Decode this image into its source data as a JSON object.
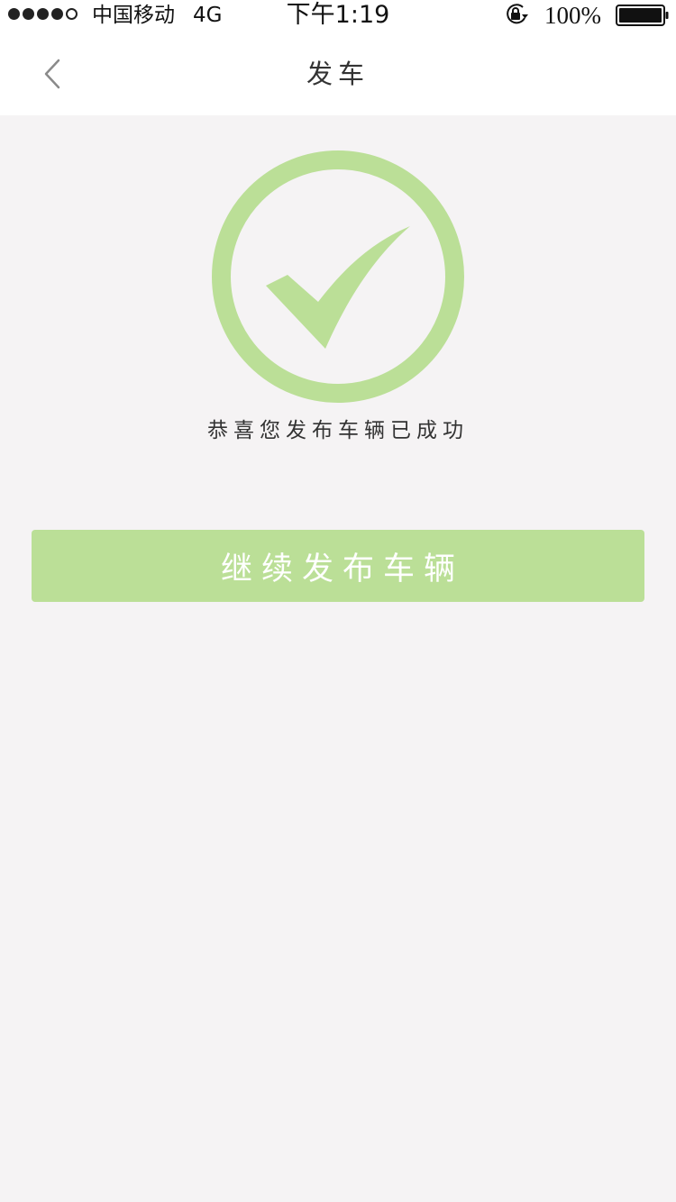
{
  "status_bar": {
    "carrier": "中国移动",
    "network": "4G",
    "time": "下午1:19",
    "battery_percent": "100%",
    "signal_bars_filled": 4,
    "signal_bars_total": 5,
    "icons": [
      "signal-icon",
      "orientation-lock-icon",
      "battery-icon"
    ]
  },
  "nav": {
    "title": "发车",
    "back_icon": "chevron-left-icon"
  },
  "success": {
    "icon": "check-circle-icon",
    "message": "恭喜您发布车辆已成功"
  },
  "actions": {
    "continue_label": "继续发布车辆"
  },
  "colors": {
    "accent": "#bbdf97",
    "background": "#f5f3f4",
    "surface": "#ffffff",
    "text": "#333333"
  }
}
